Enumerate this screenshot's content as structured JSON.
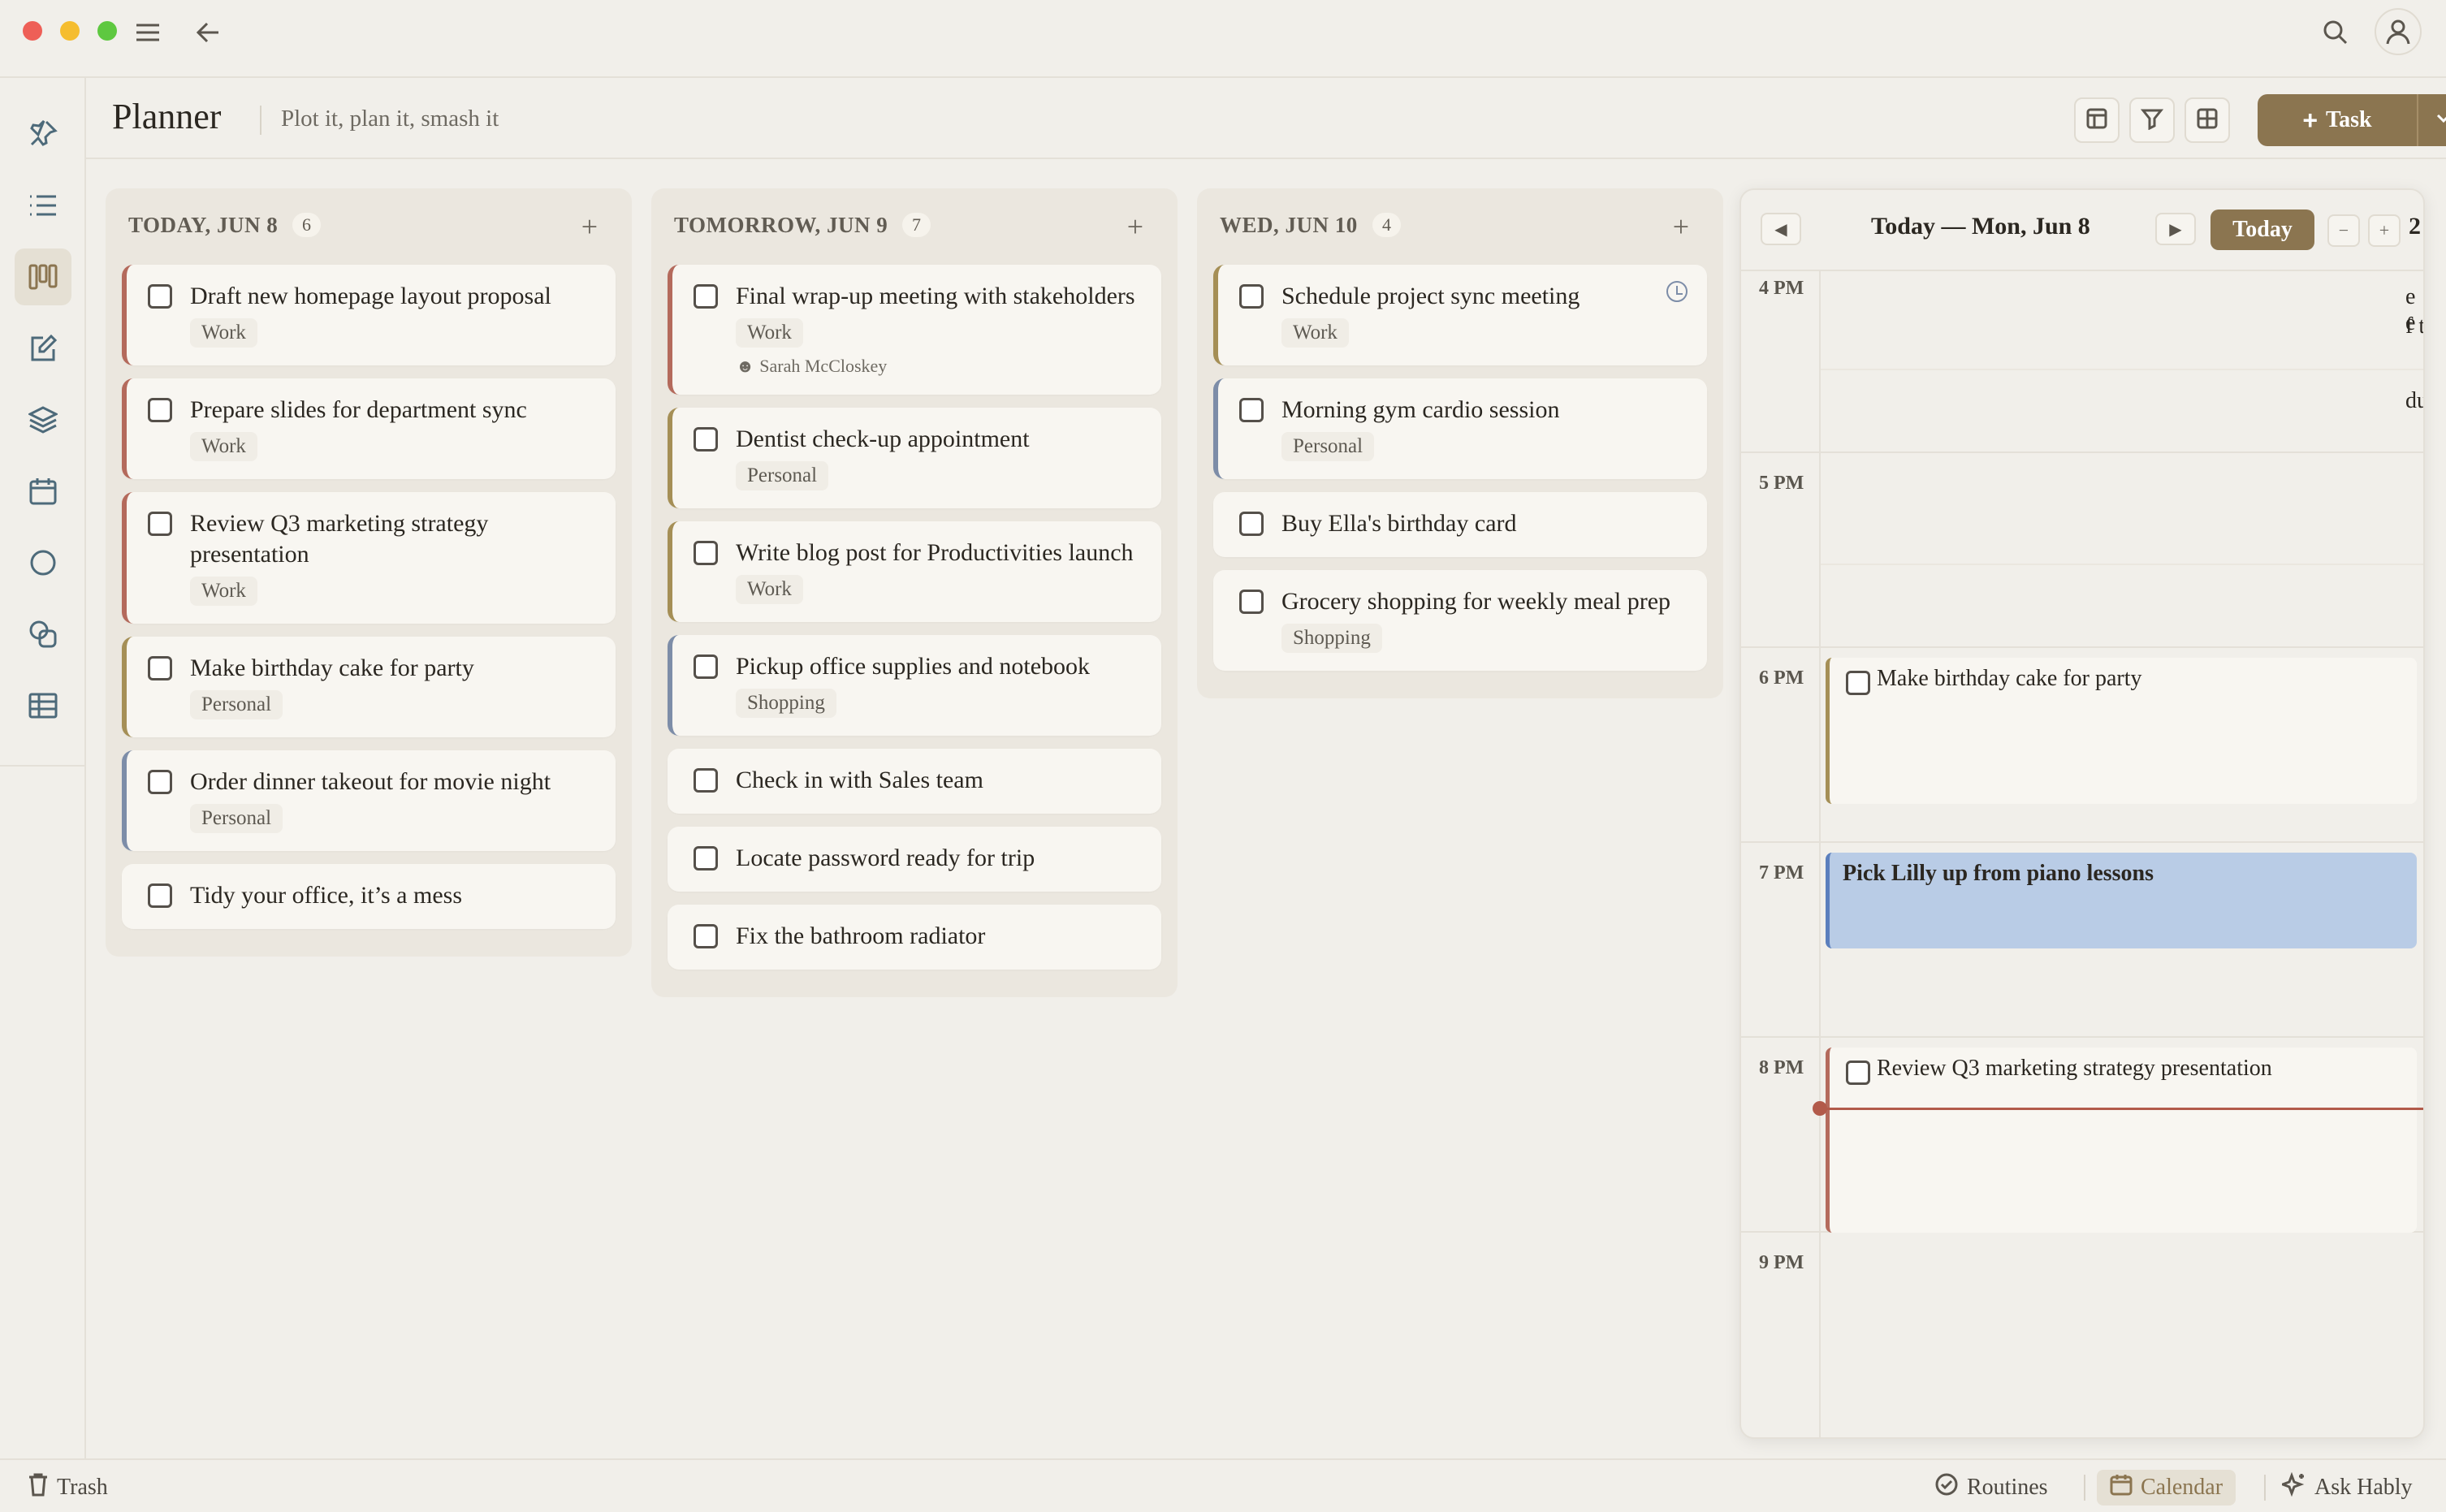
{
  "app": {
    "title": "Planner",
    "subtitle": "Plot it, plan it, smash it",
    "task_button_label": "Task",
    "accent_color": "#8b7550"
  },
  "rail": {
    "items": [
      "pin-icon",
      "list-icon",
      "board-icon",
      "edit-icon",
      "layers-icon",
      "calendar-icon",
      "circle-icon",
      "shapes-icon",
      "table-icon"
    ],
    "active": "board-icon"
  },
  "columns": [
    {
      "title": "TODAY, JUN 8",
      "count": "6",
      "cards": [
        {
          "title": "Draft new homepage layout proposal",
          "tag": "Work",
          "color": "work"
        },
        {
          "title": "Prepare slides for department sync",
          "tag": "Work",
          "color": "work"
        },
        {
          "title": "Review Q3 marketing strategy presentation",
          "tag": "Work",
          "color": "work"
        },
        {
          "title": "Make birthday cake for party",
          "tag": "Personal",
          "color": "personal"
        },
        {
          "title": "Order dinner takeout for movie night",
          "tag": "Personal",
          "color": "shopping"
        },
        {
          "title": "Tidy your office, it’s a mess",
          "tag": "",
          "color": "none"
        }
      ]
    },
    {
      "title": "TOMORROW, JUN 9",
      "count": "7",
      "cards": [
        {
          "title": "Final wrap-up meeting with stakeholders",
          "tag": "Work",
          "assignee": "Sarah McCloskey",
          "color": "work"
        },
        {
          "title": "Dentist check-up appointment",
          "tag": "Personal",
          "color": "personal"
        },
        {
          "title": "Write blog post for Productivities launch",
          "tag": "Work",
          "color": "work2"
        },
        {
          "title": "Pickup office supplies and notebook",
          "tag": "Shopping",
          "color": "shopping"
        },
        {
          "title": "Check in with Sales team",
          "tag": "",
          "color": "none"
        },
        {
          "title": "Locate password ready for trip",
          "tag": "",
          "color": "none"
        },
        {
          "title": "Fix the bathroom radiator",
          "tag": "",
          "color": "none"
        }
      ]
    },
    {
      "title": "WED, JUN 10",
      "count": "4",
      "cards": [
        {
          "title": "Schedule project sync meeting",
          "tag": "Work",
          "color": "work2",
          "clock": true
        },
        {
          "title": "Morning gym cardio session",
          "tag": "Personal",
          "color": "shopping"
        },
        {
          "title": "Buy Ella's birthday card",
          "tag": "",
          "color": "none"
        },
        {
          "title": "Grocery shopping for weekly meal prep",
          "tag": "Shopping",
          "color": "none"
        }
      ]
    }
  ],
  "calendar": {
    "title": "Today — Mon, Jun 8",
    "today_label": "Today",
    "zoom_out": "−",
    "zoom_in": "+",
    "peek_day": "2",
    "hours": [
      "4 PM",
      "5 PM",
      "6 PM",
      "7 PM",
      "8 PM",
      "9 PM"
    ],
    "events": [
      {
        "title": "Make birthday cake for party",
        "style": "task"
      },
      {
        "title": "Pick Lilly up from piano lessons",
        "style": "block"
      },
      {
        "title": "Review Q3 marketing strategy presentation",
        "style": "task-red"
      }
    ],
    "peek_fragments": [
      "e e",
      "f t",
      "dul"
    ]
  },
  "bottom": {
    "trash": "Trash",
    "routines": "Routines",
    "calendar": "Calendar",
    "ask": "Ask Hably"
  }
}
